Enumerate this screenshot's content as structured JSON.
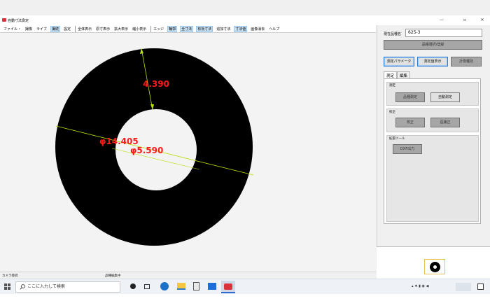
{
  "window": {
    "title": "自動寸法測定",
    "controls": [
      "—",
      "▫",
      "✕"
    ]
  },
  "menu": {
    "items": [
      {
        "label": "ファイル・",
        "hl": false
      },
      {
        "label": "撮像",
        "hl": false
      },
      {
        "label": "ライブ",
        "hl": false
      },
      {
        "label": "撮続",
        "hl": true
      },
      {
        "label": "設定",
        "hl": false
      },
      {
        "label": "全体表示",
        "hl": false,
        "sep": true
      },
      {
        "label": "原寸表示",
        "hl": false
      },
      {
        "label": "拡大表示",
        "hl": false
      },
      {
        "label": "縮小表示",
        "hl": false
      },
      {
        "label": "エッジ",
        "hl": false,
        "sep": true
      },
      {
        "label": "輪郭",
        "hl": true
      },
      {
        "label": "全寸法",
        "hl": true
      },
      {
        "label": "有効寸法",
        "hl": true
      },
      {
        "label": "追加寸法",
        "hl": false
      },
      {
        "label": "寸法値",
        "hl": true
      },
      {
        "label": "画像消去",
        "hl": false
      },
      {
        "label": "ヘルプ",
        "hl": false
      }
    ]
  },
  "measurements": {
    "height_label": "4.390",
    "outer_diameter_label": "φ14.405",
    "inner_diameter_label": "φ5.590"
  },
  "status": {
    "left": "カメラ接続",
    "middle": "品種編集中"
  },
  "panel": {
    "product_label": "現在品種名",
    "product_value": "625-3",
    "select_product_button": "品種選択/登録",
    "param_button": "測定パラメータ",
    "value_display_button": "測定値表示",
    "history_button": "計測種別",
    "tabs": [
      "測定",
      "編集"
    ],
    "groups": {
      "measure": {
        "title": "測定",
        "btn1": "品種測定",
        "btn2": "自動測定"
      },
      "calib": {
        "title": "校正",
        "btn1": "校正",
        "btn2": "歪補正"
      },
      "ext": {
        "title": "拡張ツール",
        "btn1": "DXF出力"
      }
    }
  },
  "taskbar": {
    "search_placeholder": "ここに入力して検索"
  },
  "colors": {
    "dimension_text": "#ff1a1a",
    "dimension_line": "#b6e000",
    "disc": "#000000"
  }
}
